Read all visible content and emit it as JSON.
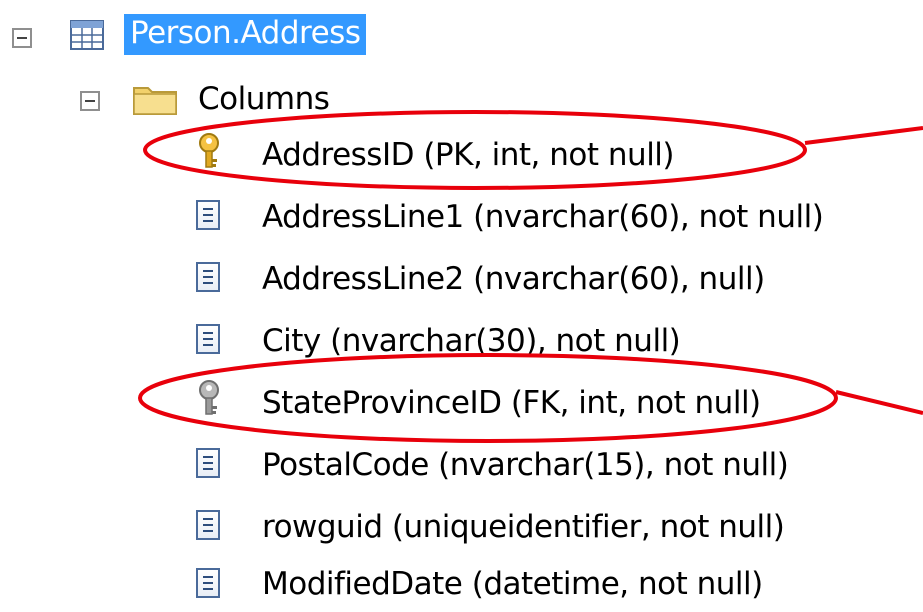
{
  "tree": {
    "table": {
      "label": "Person.Address"
    },
    "folder": {
      "label": "Columns"
    },
    "columns": [
      {
        "label": "AddressID (PK, int, not null)",
        "icon": "primary-key-icon"
      },
      {
        "label": "AddressLine1 (nvarchar(60), not null)",
        "icon": "column-icon"
      },
      {
        "label": "AddressLine2 (nvarchar(60), null)",
        "icon": "column-icon"
      },
      {
        "label": "City (nvarchar(30), not null)",
        "icon": "column-icon"
      },
      {
        "label": "StateProvinceID (FK, int, not null)",
        "icon": "foreign-key-icon"
      },
      {
        "label": "PostalCode (nvarchar(15), not null)",
        "icon": "column-icon"
      },
      {
        "label": "rowguid (uniqueidentifier, not null)",
        "icon": "column-icon"
      },
      {
        "label": "ModifiedDate (datetime, not null)",
        "icon": "column-icon"
      }
    ]
  },
  "colors": {
    "selection": "#3399ff",
    "annotation": "#e8000b"
  }
}
